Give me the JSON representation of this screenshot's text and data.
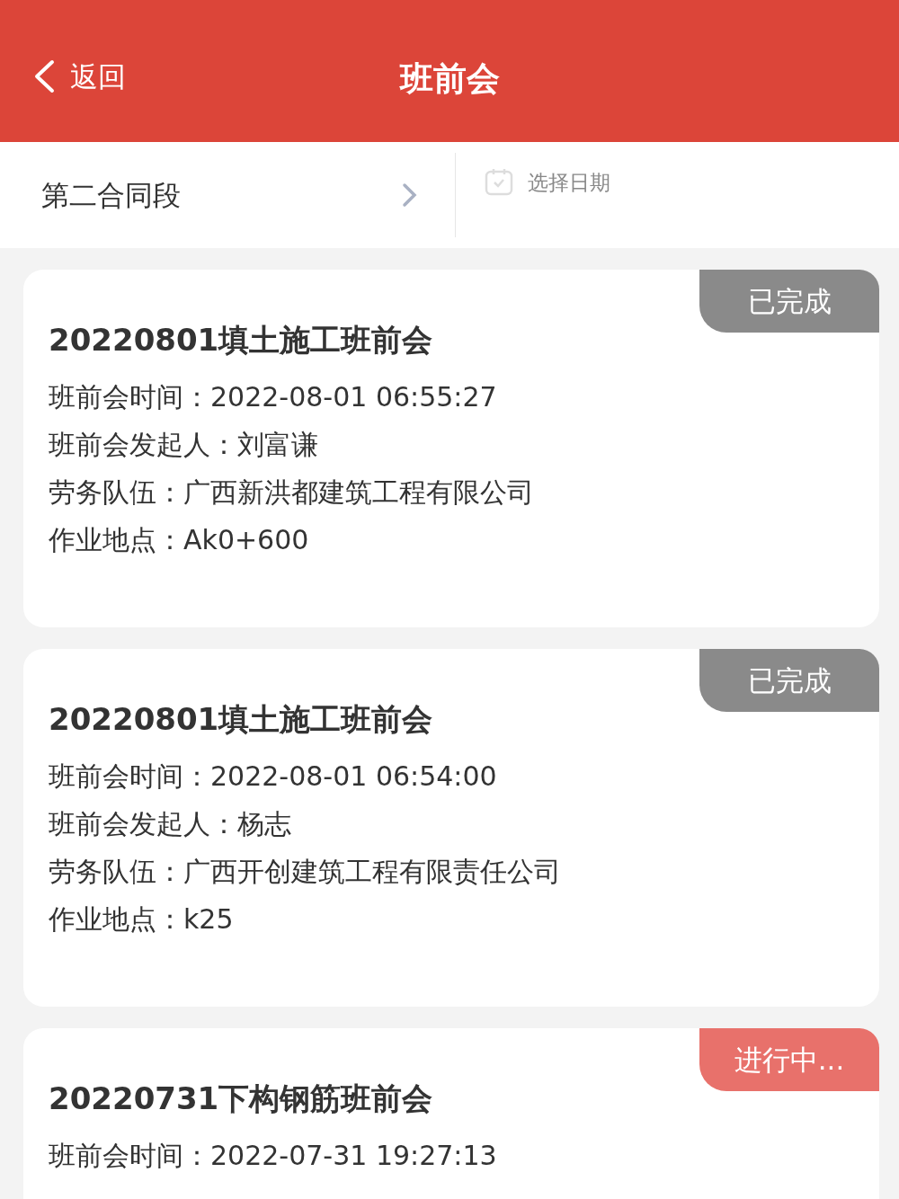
{
  "header": {
    "back": "返回",
    "title": "班前会"
  },
  "filter": {
    "section": "第二合同段",
    "date_placeholder": "选择日期"
  },
  "meetings": [
    {
      "title": "20220801填土施工班前会",
      "status": {
        "kind": "done",
        "label": "已完成"
      },
      "lines": [
        "班前会时间：2022-08-01 06:55:27",
        "班前会发起人：刘富谦",
        "劳务队伍：广西新洪都建筑工程有限公司",
        "作业地点：Ak0+600"
      ]
    },
    {
      "title": "20220801填土施工班前会",
      "status": {
        "kind": "done",
        "label": "已完成"
      },
      "lines": [
        "班前会时间：2022-08-01 06:54:00",
        "班前会发起人：杨志",
        "劳务队伍：广西开创建筑工程有限责任公司",
        "作业地点：k25"
      ]
    },
    {
      "title": "20220731下构钢筋班前会",
      "status": {
        "kind": "active",
        "label": "进行中..."
      },
      "lines": [
        "班前会时间：2022-07-31 19:27:13"
      ]
    }
  ]
}
